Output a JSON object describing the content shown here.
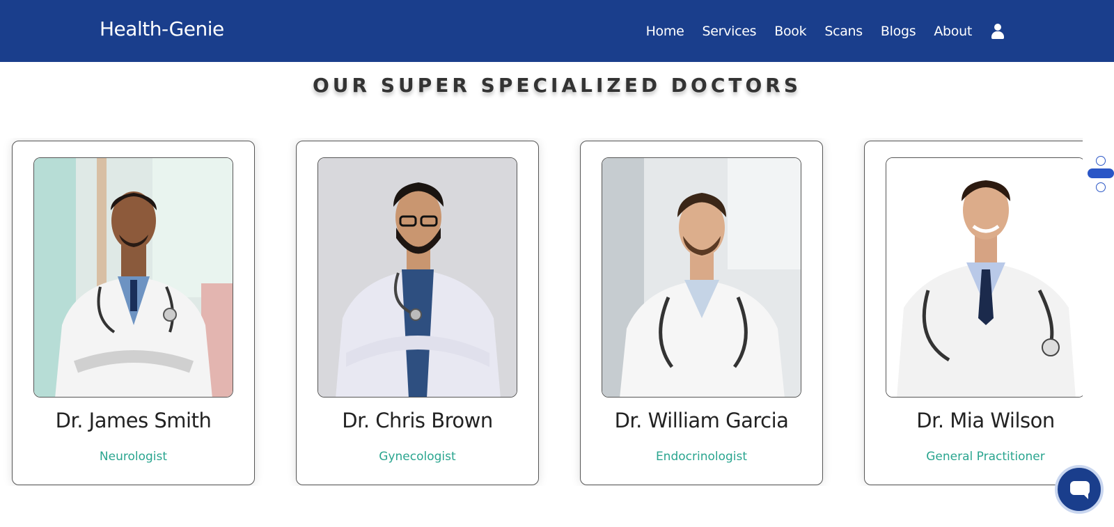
{
  "header": {
    "brand": "Health-Genie",
    "nav": [
      "Home",
      "Services",
      "Book",
      "Scans",
      "Blogs",
      "About"
    ],
    "user_icon": "user-icon"
  },
  "section": {
    "title": "OUR SUPER SPECIALIZED DOCTORS"
  },
  "doctors": [
    {
      "name": "Dr. James Smith",
      "specialty": "Neurologist"
    },
    {
      "name": "Dr. Chris Brown",
      "specialty": "Gynecologist"
    },
    {
      "name": "Dr. William Garcia",
      "specialty": "Endocrinologist"
    },
    {
      "name": "Dr. Mia Wilson",
      "specialty": "General Practitioner"
    }
  ],
  "colors": {
    "header_bg": "#1a3e8c",
    "specialty_text": "#2aa58f",
    "indicator": "#2a56c6"
  }
}
